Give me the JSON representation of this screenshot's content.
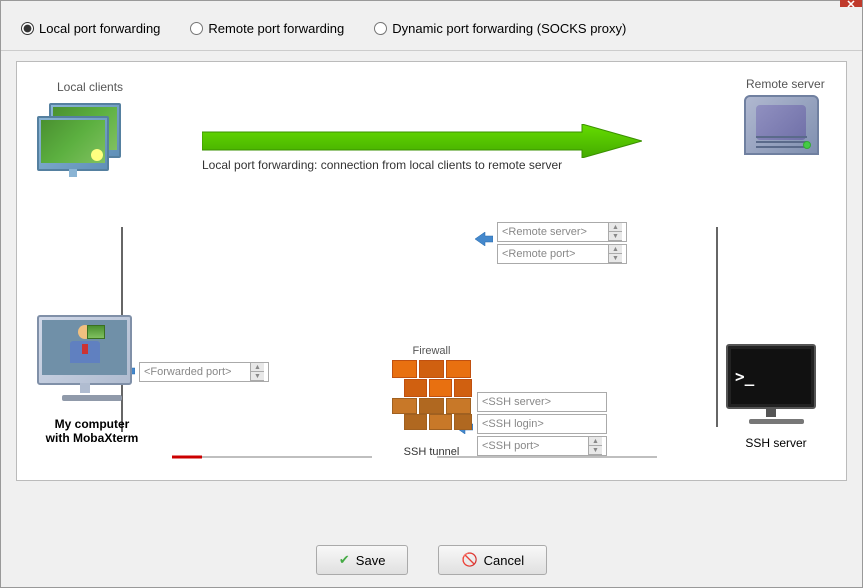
{
  "window": {
    "close_label": "✕"
  },
  "radio_options": [
    {
      "id": "local",
      "label": "Local port forwarding",
      "checked": true
    },
    {
      "id": "remote",
      "label": "Remote port forwarding",
      "checked": false
    },
    {
      "id": "dynamic",
      "label": "Dynamic port forwarding (SOCKS proxy)",
      "checked": false
    }
  ],
  "diagram": {
    "local_clients_label": "Local clients",
    "remote_server_label": "Remote server",
    "my_computer_label": "My computer\nwith MobaXterm",
    "ssh_server_label": "SSH server",
    "firewall_label": "Firewall",
    "ssh_tunnel_label": "SSH tunnel",
    "arrow_description": "Local port forwarding: connection from local clients to remote server",
    "remote_server_input": "<Remote server>",
    "remote_port_input": "<Remote port>",
    "ssh_server_input": "<SSH server>",
    "ssh_login_input": "<SSH login>",
    "ssh_port_input": "<SSH port>",
    "forwarded_port_input": "<Forwarded port>"
  },
  "buttons": {
    "save_label": "Save",
    "save_icon": "✔",
    "cancel_label": "Cancel",
    "cancel_icon": "🚫"
  }
}
